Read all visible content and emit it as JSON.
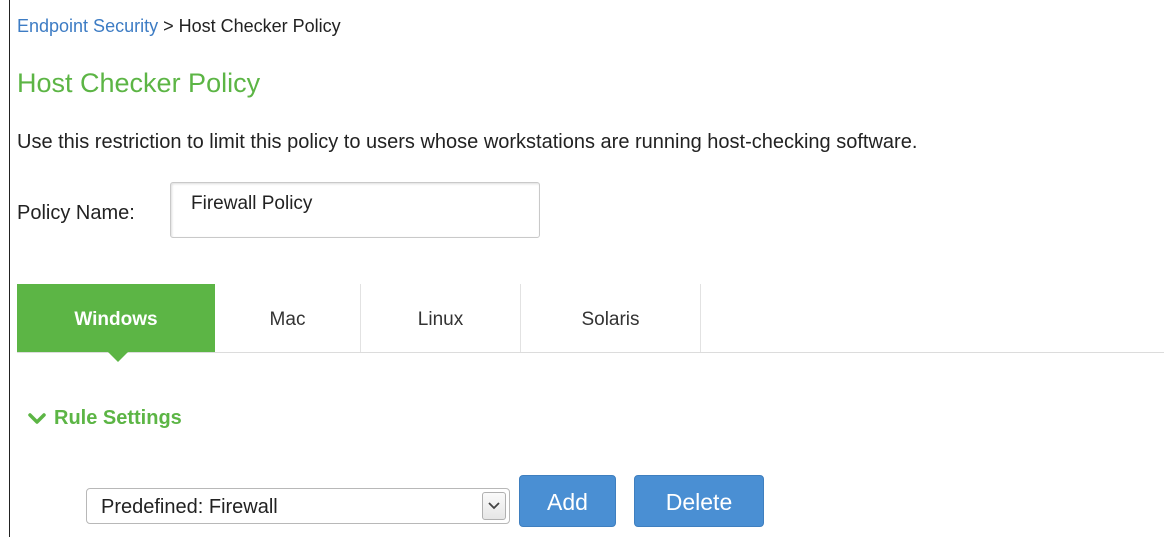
{
  "breadcrumb": {
    "parent": "Endpoint Security",
    "separator": " > ",
    "current": "Host Checker Policy"
  },
  "page_title": "Host Checker Policy",
  "description": "Use this restriction to limit this policy to users whose workstations are running host-checking software.",
  "policy_name": {
    "label": "Policy Name:",
    "value": "Firewall Policy"
  },
  "tabs": [
    {
      "label": "Windows",
      "active": true
    },
    {
      "label": "Mac",
      "active": false
    },
    {
      "label": "Linux",
      "active": false
    },
    {
      "label": "Solaris",
      "active": false
    }
  ],
  "rule_settings": {
    "label": "Rule Settings",
    "icon": "chevron-down-icon"
  },
  "rule_select": {
    "value": "Predefined: Firewall"
  },
  "buttons": {
    "add": "Add",
    "delete": "Delete"
  },
  "colors": {
    "accent_green": "#5cb545",
    "link_blue": "#3d7cc4",
    "button_blue": "#4a8fd3"
  }
}
